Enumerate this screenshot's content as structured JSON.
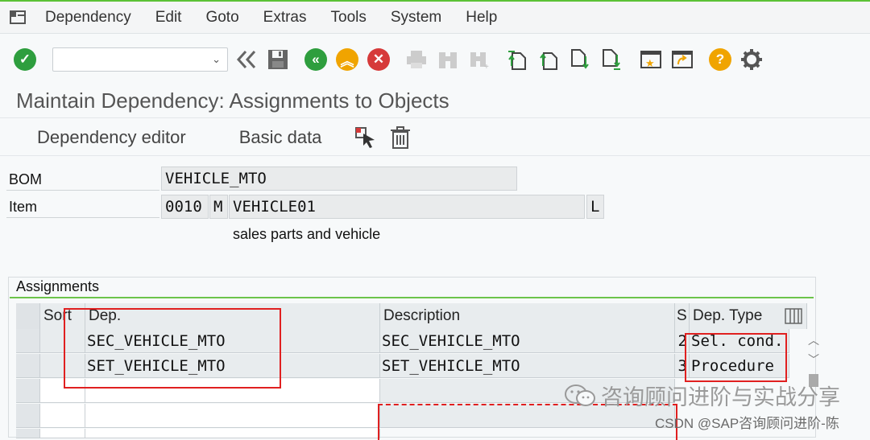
{
  "menubar": {
    "items": [
      {
        "label": "Dependency"
      },
      {
        "label": "Edit"
      },
      {
        "label": "Goto"
      },
      {
        "label": "Extras"
      },
      {
        "label": "Tools"
      },
      {
        "label": "System"
      },
      {
        "label": "Help"
      }
    ]
  },
  "toolbar": {
    "command_value": "",
    "icons": [
      "check-icon",
      "command-field",
      "double-chevron-left-icon",
      "save-icon",
      "back-icon",
      "exit-icon",
      "cancel-icon",
      "print-icon",
      "find-icon",
      "find-next-icon",
      "first-page-icon",
      "previous-page-icon",
      "next-page-icon",
      "last-page-icon",
      "create-session-icon",
      "shortcut-icon",
      "help-icon",
      "settings-icon"
    ]
  },
  "title": "Maintain Dependency: Assignments to Objects",
  "subbar": {
    "dependency_editor": "Dependency editor",
    "basic_data": "Basic data"
  },
  "header": {
    "bom_label": "BOM",
    "bom_value": "VEHICLE_MTO",
    "item_label": "Item",
    "item_number": "0010",
    "item_category": "M",
    "item_material": "VEHICLE01",
    "item_flag": "L",
    "item_description": "sales parts and vehicle"
  },
  "assignments": {
    "title": "Assignments",
    "columns": {
      "sort": "Sort",
      "dep": "Dep.",
      "description": "Description",
      "s": "S",
      "dep_type": "Dep. Type"
    },
    "rows": [
      {
        "sort": "",
        "dep": "SEC_VEHICLE_MTO",
        "description": "SEC_VEHICLE_MTO",
        "s": "2",
        "dep_type": "Sel. cond."
      },
      {
        "sort": "",
        "dep": "SET_VEHICLE_MTO",
        "description": "SET_VEHICLE_MTO",
        "s": "3",
        "dep_type": "Procedure"
      }
    ]
  },
  "watermark": {
    "text": "咨询顾问进阶与实战分享",
    "credit": "CSDN @SAP咨询顾问进阶-陈"
  },
  "colors": {
    "accent_green": "#5bc236",
    "highlight_red": "#e02020"
  }
}
